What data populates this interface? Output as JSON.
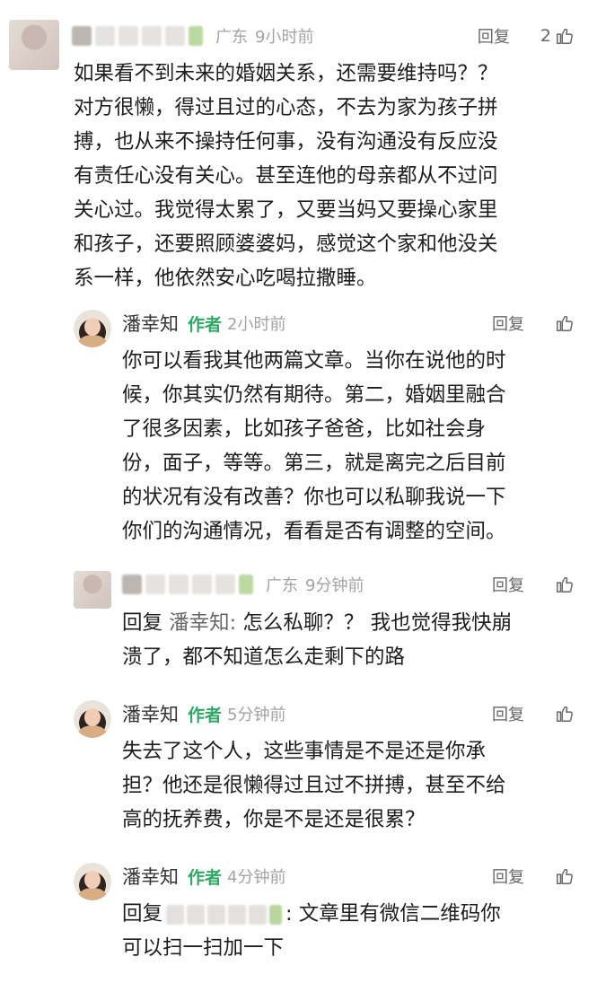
{
  "thread": {
    "c1": {
      "location": "广东",
      "time": "9小时前",
      "reply_label": "回复",
      "like_count": "2",
      "lines": [
        "如果看不到未来的婚姻关系，还需要维持吗？？",
        "对方很懒，得过且过的心态，不去为家为孩子拼",
        "搏，也从来不操持任何事，没有沟通没有反应没",
        "有责任心没有关心。甚至连他的母亲都从不过问",
        "关心过。我觉得太累了，又要当妈又要操心家里",
        "和孩子，还要照顾婆婆妈，感觉这个家和他没关",
        "系一样，他依然安心吃喝拉撒睡。"
      ]
    },
    "c2": {
      "author": "潘幸知",
      "badge": "作者",
      "time": "2小时前",
      "reply_label": "回复",
      "lines": [
        "你可以看我其他两篇文章。当你在说他的时",
        "候，你其实仍然有期待。第二，婚姻里融合",
        "了很多因素，比如孩子爸爸，比如社会身",
        "份，面子，等等。第三，就是离完之后目前",
        "的状况有没有改善？你也可以私聊我说一下",
        "你们的沟通情况，看看是否有调整的空间。"
      ]
    },
    "c3": {
      "location": "广东",
      "time": "9分钟前",
      "reply_label": "回复",
      "reply_prefix": "回复",
      "reply_target": "潘幸知:",
      "first_line_rest": " 怎么私聊？？ 我也觉得我快崩",
      "lines": [
        "溃了，都不知道怎么走剩下的路"
      ]
    },
    "c4": {
      "author": "潘幸知",
      "badge": "作者",
      "time": "5分钟前",
      "reply_label": "回复",
      "lines": [
        "失去了这个人，这些事情是不是还是你承",
        "担？他还是很懒得过且过不拼搏，甚至不给",
        "高的抚养费，你是不是还是很累？"
      ]
    },
    "c5": {
      "author": "潘幸知",
      "badge": "作者",
      "time": "4分钟前",
      "reply_label": "回复",
      "reply_prefix": "回复",
      "first_line_rest": ": 文章里有微信二维码你",
      "lines": [
        "可以扫一扫加一下"
      ]
    }
  },
  "icons": {
    "like": "thumbs-up-icon"
  },
  "colors": {
    "author_badge": "#2fa866",
    "meta_gray": "#a3a3a3"
  }
}
